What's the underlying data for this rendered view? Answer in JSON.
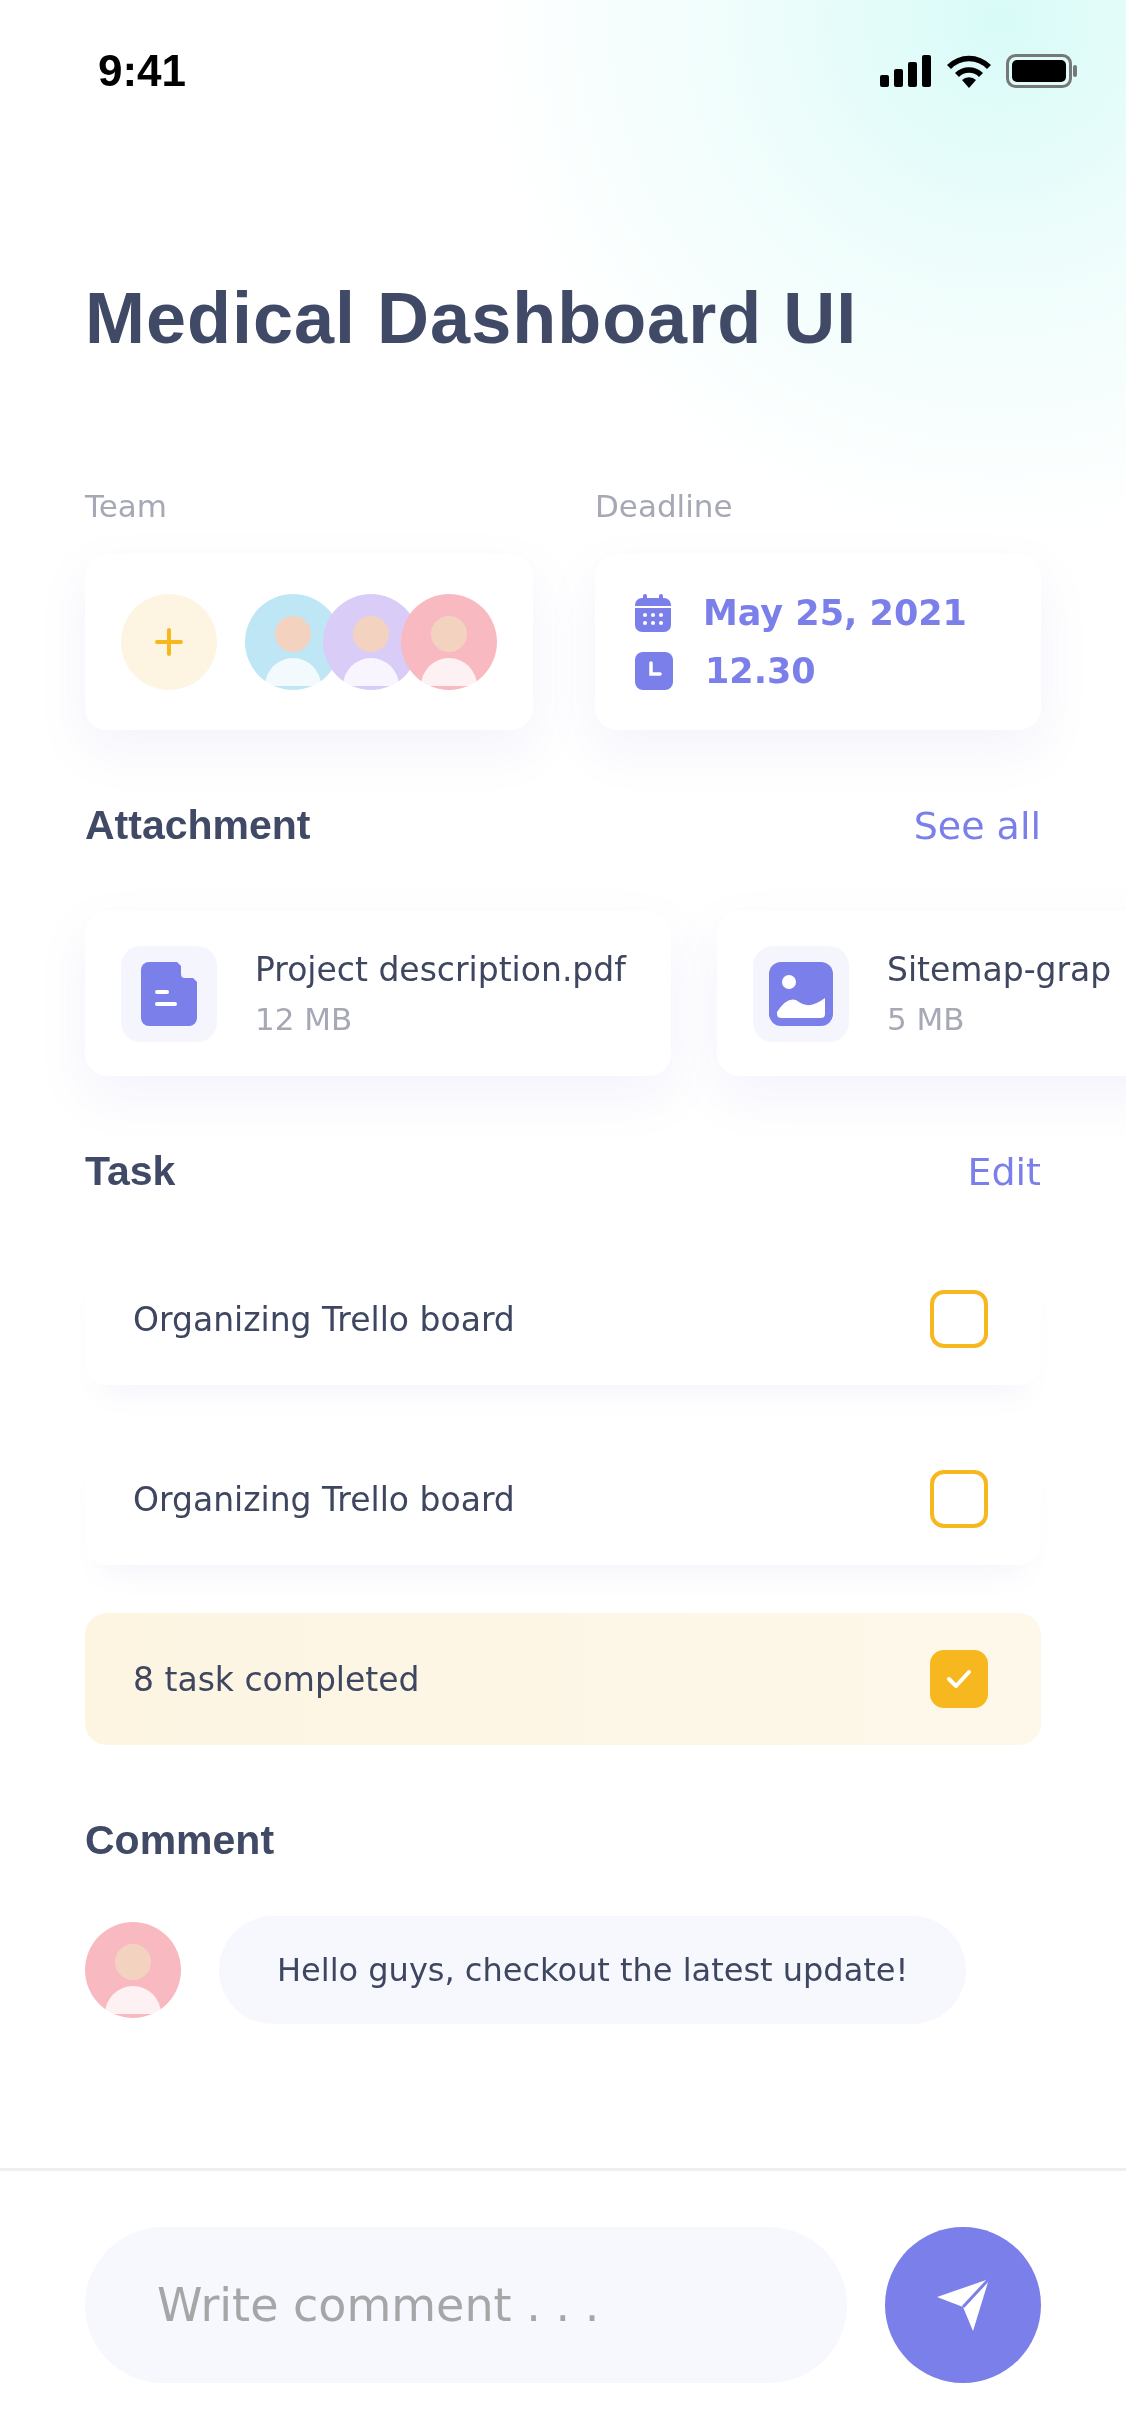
{
  "status_bar": {
    "time": "9:41"
  },
  "title": "Medical Dashboard UI",
  "team": {
    "label": "Team",
    "members": [
      {
        "color": "#bfe6f5"
      },
      {
        "color": "#d9ccf7"
      },
      {
        "color": "#f9b9c0"
      }
    ]
  },
  "deadline": {
    "label": "Deadline",
    "date": "May 25, 2021",
    "time": "12.30"
  },
  "attachments": {
    "title": "Attachment",
    "action": "See all",
    "files": [
      {
        "kind": "document",
        "name": "Project description.pdf",
        "size": "12 MB"
      },
      {
        "kind": "image",
        "name": "Sitemap-grap",
        "size": "5 MB"
      }
    ]
  },
  "tasks": {
    "title": "Task",
    "action": "Edit",
    "items": [
      {
        "label": "Organizing Trello board",
        "checked": false
      },
      {
        "label": "Organizing Trello board",
        "checked": false
      },
      {
        "label": "8 task completed",
        "checked": true
      }
    ]
  },
  "comments": {
    "title": "Comment",
    "items": [
      {
        "text": "Hello guys, checkout the latest update!"
      }
    ]
  },
  "composer": {
    "placeholder": "Write comment . . ."
  }
}
